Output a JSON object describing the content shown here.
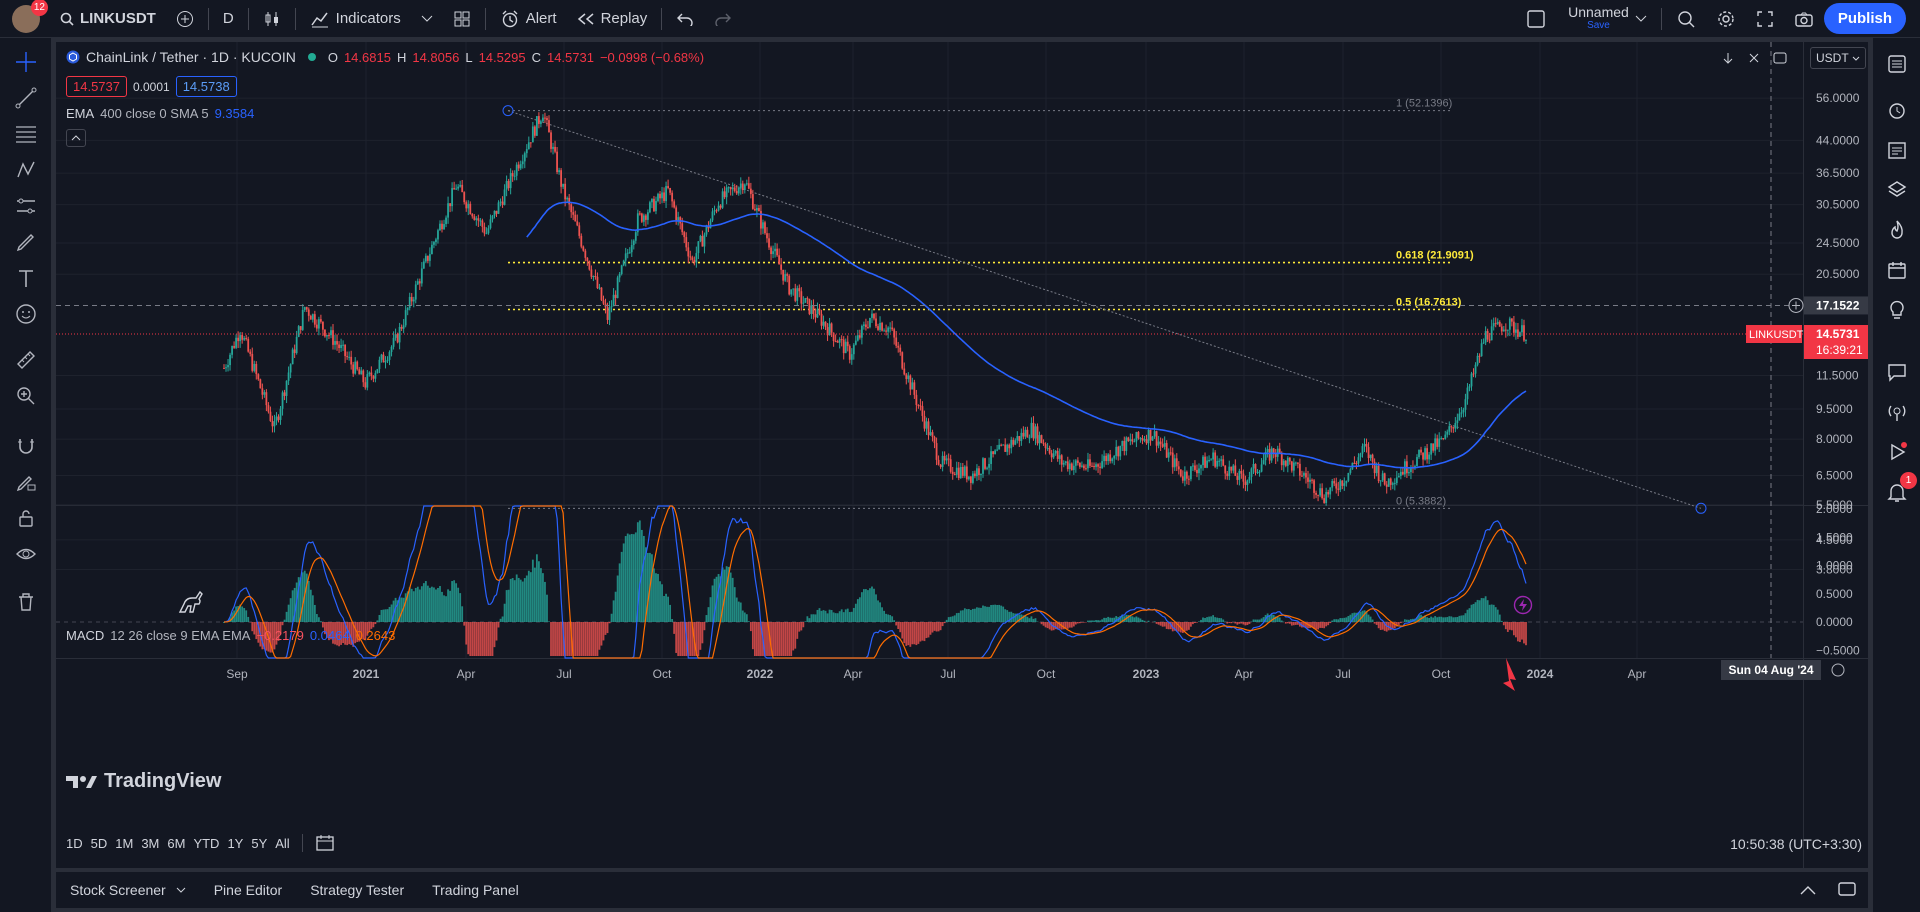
{
  "topbar": {
    "notification_count": "12",
    "symbol": "LINKUSDT",
    "interval": "D",
    "indicators_label": "Indicators",
    "alert_label": "Alert",
    "replay_label": "Replay",
    "layout_name": "Unnamed",
    "save_label": "Save",
    "publish_label": "Publish"
  },
  "legend": {
    "pair": "ChainLink / Tether · 1D · KUCOIN",
    "o_label": "O",
    "o": "14.6815",
    "h_label": "H",
    "h": "14.8056",
    "l_label": "L",
    "l": "14.5295",
    "c_label": "C",
    "c": "14.5731",
    "change": "−0.0998 (−0.68%)",
    "bid": "14.5737",
    "spread": "0.0001",
    "ask": "14.5738",
    "ema_title": "EMA",
    "ema_params": "400 close 0 SMA 5",
    "ema_value": "9.3584",
    "macd_title": "MACD",
    "macd_params": "12 26 close 9 EMA EMA",
    "macd_hist": "−0.2179",
    "macd_line": "0.0464",
    "macd_signal": "0.2643"
  },
  "chart": {
    "currency_button": "USDT",
    "price_scale": [
      "56.0000",
      "44.0000",
      "36.5000",
      "30.5000",
      "24.5000",
      "20.5000",
      "17.1522",
      "14.5731",
      "11.5000",
      "9.5000",
      "8.0000",
      "6.5000",
      "5.5000",
      "4.5000",
      "3.8000"
    ],
    "crosshair_price": "17.1522",
    "last_price_symbol": "LINKUSDT",
    "last_price": "14.5731",
    "countdown": "16:39:21",
    "fib_labels": [
      "1 (52.1396)",
      "0.618 (21.9091)",
      "0.5 (16.7613)",
      "0 (5.3882)"
    ],
    "macd_scale": [
      "2.0000",
      "1.5000",
      "1.0000",
      "0.5000",
      "0.0000",
      "−0.5000"
    ],
    "time_axis": [
      "Sep",
      "2021",
      "Apr",
      "Jul",
      "Oct",
      "2022",
      "Apr",
      "Jul",
      "Oct",
      "2023",
      "Apr",
      "Jul",
      "Oct",
      "2024",
      "Apr"
    ],
    "crosshair_date": "Sun 04 Aug '24",
    "watermark": "TradingView",
    "colors": {
      "up": "#26a69a",
      "down": "#ef5350",
      "ema": "#2962ff",
      "macd": "#2962ff",
      "signal": "#ff6d00",
      "fib": "#ffeb3b",
      "accent": "#2962ff"
    }
  },
  "ranges": [
    "1D",
    "5D",
    "1M",
    "3M",
    "6M",
    "YTD",
    "1Y",
    "5Y",
    "All"
  ],
  "clock": "10:50:38 (UTC+3:30)",
  "bottom_tabs": [
    "Stock Screener",
    "Pine Editor",
    "Strategy Tester",
    "Trading Panel"
  ],
  "right_badge": "1"
}
